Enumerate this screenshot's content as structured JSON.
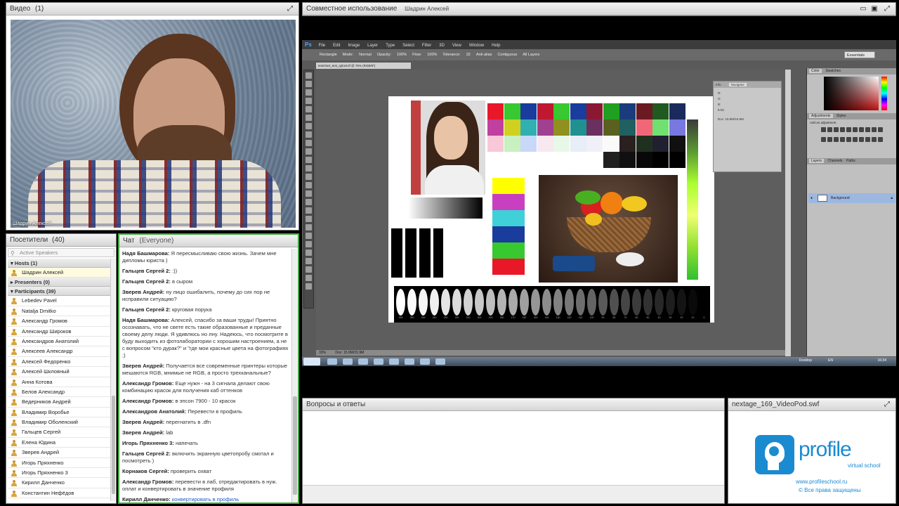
{
  "video_pod": {
    "title": "Видео",
    "count": "(1)",
    "presenter": "Шадрин Алексей"
  },
  "share_pod": {
    "title": "Совместное использование",
    "presenter": "Шадрин Алексей"
  },
  "attendees": {
    "title": "Посетители",
    "count": "(40)",
    "search_placeholder": "Active Speakers",
    "hosts_label": "Hosts (1)",
    "host": "Шадрин Алексей",
    "presenters_label": "Presenters (0)",
    "participants_label": "Participants (39)",
    "participants": [
      "Lebedev Pavel",
      "Natalja Dmitko",
      "Александр Громов",
      "Александр Широков",
      "Александров Анатолий",
      "Алексеев Александр",
      "Алексей Федоренко",
      "Алексей Шкловный",
      "Анна Котова",
      "Белов Александр",
      "Ведерников Андрей",
      "Владимир Воробье",
      "Владимир Оболенский",
      "Гальцев Сергей",
      "Елена Юдина",
      "Зверев Андрей",
      "Игорь Пряхненко",
      "Игорь Пряхненко 3",
      "Кирилл Данченко",
      "Константин Нефёдов"
    ]
  },
  "chat": {
    "title": "Чат",
    "scope": "(Everyone)",
    "messages": [
      {
        "name": "Надя Башмарова:",
        "text": "Я пересмысливаю свою жизнь. Зачем мне дипломы юриста )"
      },
      {
        "name": "Гальцев Сергей 2:",
        "text": ":))"
      },
      {
        "name": "Гальцев Сергей 2:",
        "text": "в сыром"
      },
      {
        "name": "Зверев Андрей:",
        "text": "ну лицо ошибалить, почему до сих пор не исправили ситуацию?"
      },
      {
        "name": "Гальцев Сергей 2:",
        "text": "круговая порука"
      },
      {
        "name": "Надя Башмарова:",
        "text": "Алексей, спасибо за ваши труды! Приятно осознавать, что не свете есть такие образованные и преданные своему делу люди. Я удивлюсь но лну. Надеюсь, что посмотрите в буду выходить из фотолаборатории с хорошим настроением, а не с вопросом \"кто дурак?\" и \"где мои красные цвета на фотографиях ;)"
      },
      {
        "name": "Зверев Андрей:",
        "text": "Получается все современные принтеры которые мешаются RGB, мнимые не RGB, а просто трехканальные?"
      },
      {
        "name": "Александр Громов:",
        "text": "Еще нужн - на 3 сигнала делают свою комбинацию красок для получения каб оттенков"
      },
      {
        "name": "Александр Громов:",
        "text": "в эпсон 7900 - 10 красок"
      },
      {
        "name": "Александров Анатолий:",
        "text": "Перевести в профиль"
      },
      {
        "name": "Зверев Андрей:",
        "text": "перегнатить в  .dfn"
      },
      {
        "name": "Зверев Андрей:",
        "text": "lab"
      },
      {
        "name": "Игорь Пряхненко 3:",
        "text": "напечать"
      },
      {
        "name": "Гальцев Сергей 2:",
        "text": "включить  экранную цветопробу смотал и посмотреть )"
      },
      {
        "name": "Корнаков Сергей:",
        "text": "проверить охват"
      },
      {
        "name": "Александр Громов:",
        "text": "перевести в лаб, отредактировать в нуж. оплат и конвертировать в значение профиля"
      },
      {
        "name": "Кирилл Данченко:",
        "text": "конвертировать в профиль",
        "link": true
      }
    ]
  },
  "qa_pod": {
    "title": "Вопросы и ответы"
  },
  "file_pod": {
    "title": "nextage_169_VideoPod.swf",
    "brand": "profile",
    "sub": "virtual school",
    "url": "www.profileschool.ru",
    "rights": "© Все права защищены"
  },
  "photoshop": {
    "logo": "Ps",
    "menu": [
      "File",
      "Edit",
      "Image",
      "Layer",
      "Type",
      "Select",
      "Filter",
      "3D",
      "View",
      "Window",
      "Help"
    ],
    "options": [
      "Rectangle",
      "Mode:",
      "Normal",
      "Opacity:",
      "100%",
      "Flow:",
      "100%",
      "Tolerance:",
      "32",
      "Anti-alias",
      "Contiguous",
      "All Layers"
    ],
    "workspace": "Essentials",
    "doc_tab": "testchart_test_rgb18.tif @ 75% (RGB/8*)",
    "status": "33%",
    "status2": "Doc: 15.9M/15.9M",
    "panels": {
      "color": "Color",
      "swatches": "Swatches",
      "adjustments": "Adjustments",
      "styles": "Styles",
      "add_adj": "Add an adjustment",
      "layers": "Layers",
      "channels": "Channels",
      "paths": "Paths",
      "layer_name": "Background",
      "info": "Info",
      "histogram": "Navigator"
    },
    "grayscale_labels": [
      "255",
      "250",
      "245",
      "240",
      "230",
      "220",
      "210",
      "200",
      "190",
      "180",
      "170",
      "160",
      "150",
      "140",
      "130",
      "120",
      "110",
      "100",
      "90",
      "80",
      "70",
      "60",
      "50",
      "40",
      "30",
      "20",
      "10",
      "0"
    ]
  },
  "taskbar": {
    "lang": "EN",
    "time": "16:34",
    "date": "Desktop"
  },
  "colors": {
    "accent_green": "#3fa83f",
    "brand_blue": "#1a8bd1",
    "ps_gray": "#5a5a5a"
  }
}
